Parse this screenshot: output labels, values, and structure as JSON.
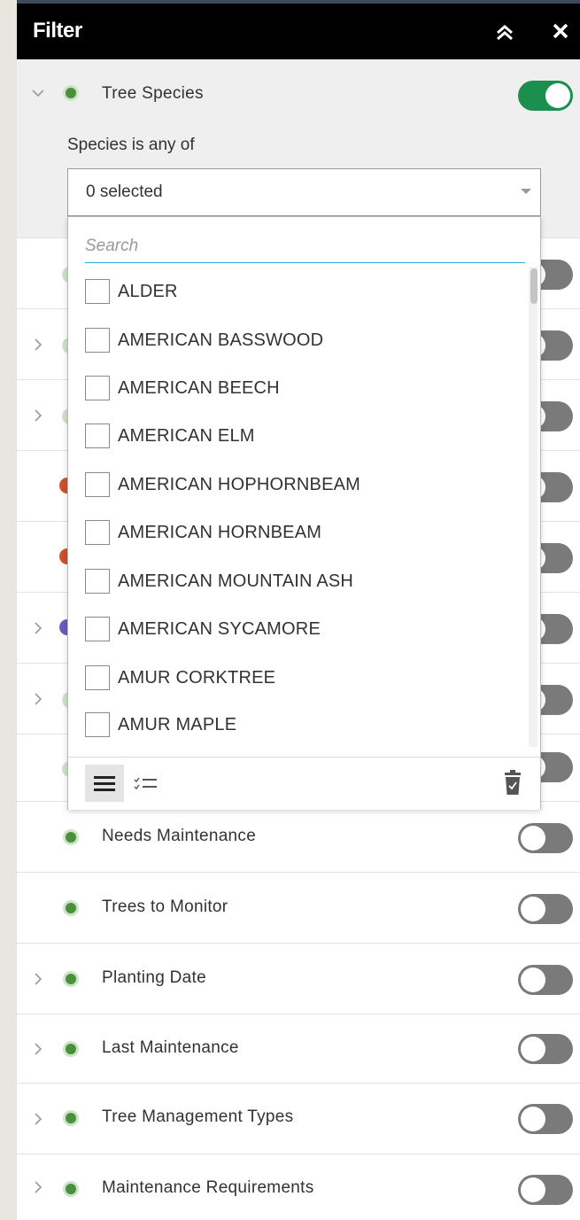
{
  "header": {
    "title": "Filter"
  },
  "expanded_filter": {
    "label": "Tree Species",
    "enabled": true,
    "clause_text": "Species is any of",
    "select_value": "0 selected",
    "search_placeholder": "Search",
    "options": [
      "ALDER",
      "AMERICAN BASSWOOD",
      "AMERICAN BEECH",
      "AMERICAN ELM",
      "AMERICAN HOPHORNBEAM",
      "AMERICAN HORNBEAM",
      "AMERICAN MOUNTAIN ASH",
      "AMERICAN SYCAMORE",
      "AMUR CORKTREE",
      "AMUR MAPLE"
    ]
  },
  "filters": [
    {
      "label": "Needs Maintenance",
      "expandable": false,
      "enabled": false
    },
    {
      "label": "Trees to Monitor",
      "expandable": false,
      "enabled": false
    },
    {
      "label": "Planting Date",
      "expandable": true,
      "enabled": false
    },
    {
      "label": "Last Maintenance",
      "expandable": true,
      "enabled": false
    },
    {
      "label": "Tree Management Types",
      "expandable": true,
      "enabled": false
    },
    {
      "label": "Maintenance Requirements",
      "expandable": true,
      "enabled": false
    }
  ],
  "colors": {
    "header_bg": "#000000",
    "toggle_on": "#1a8f4e",
    "toggle_off": "#7a7a7a",
    "layer_dot": "#4a8f3b",
    "search_underline": "#2aa7d8"
  }
}
